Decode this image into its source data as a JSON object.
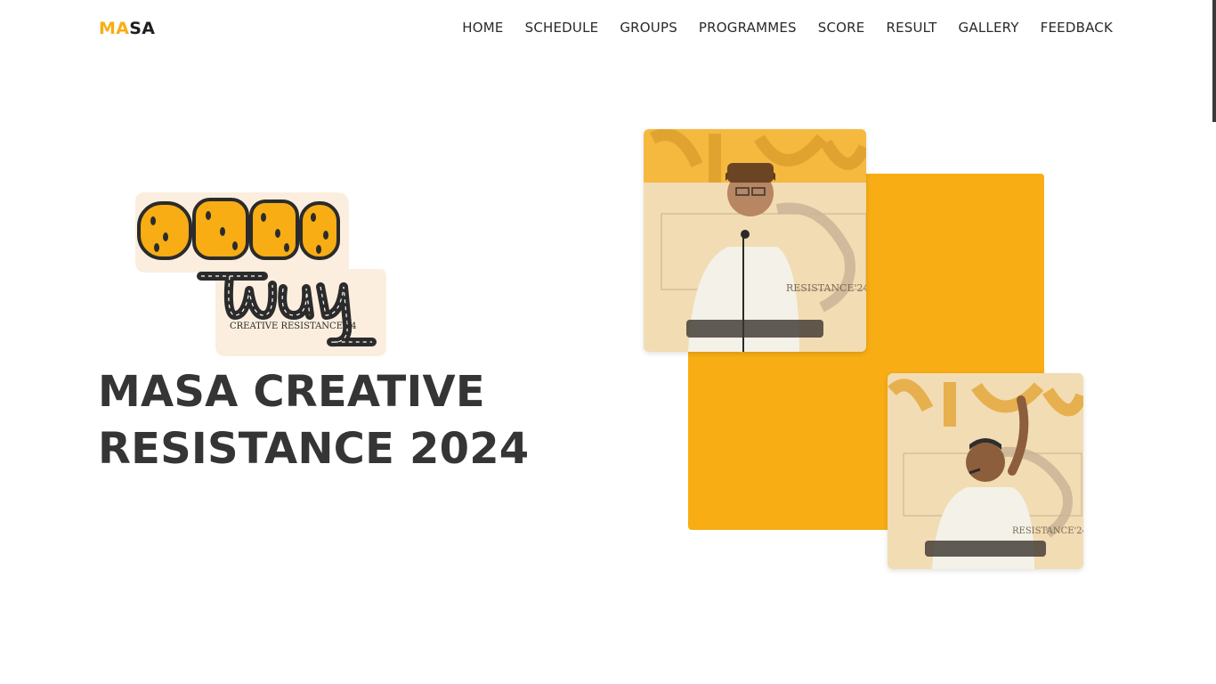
{
  "header": {
    "logo_part1": "MA",
    "logo_part2": "SA",
    "nav": [
      "HOME",
      "SCHEDULE",
      "GROUPS",
      "PROGRAMMES",
      "SCORE",
      "RESULT",
      "GALLERY",
      "FEEDBACK"
    ]
  },
  "hero": {
    "brand_caption": "CREATIVE RESISTANCE'24",
    "title_line1": "MASA CREATIVE",
    "title_line2": "RESISTANCE 2024",
    "photo_caption": "RESISTANCE'24"
  },
  "colors": {
    "accent": "#f7ad13",
    "text": "#353535",
    "background": "#ffffff"
  }
}
